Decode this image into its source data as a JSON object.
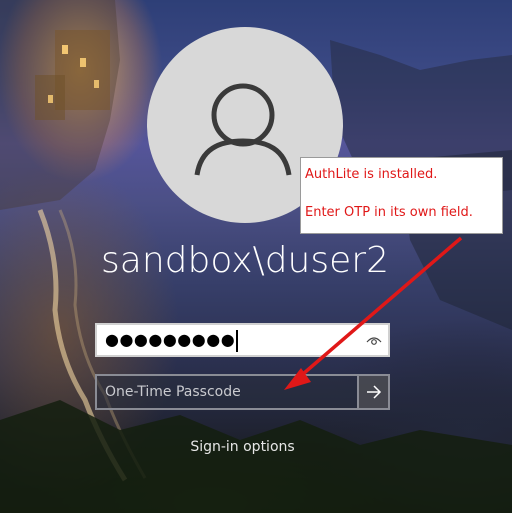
{
  "user": {
    "avatar_icon": "user-silhouette-icon",
    "username": "sandbox\\duser2"
  },
  "password": {
    "masked_value": "●●●●●●●●●",
    "reveal_icon": "eye-icon"
  },
  "otp": {
    "placeholder": "One-Time Passcode",
    "submit_icon": "arrow-right-icon"
  },
  "signin_options": {
    "label": "Sign-in options"
  },
  "annotation": {
    "line1": "AuthLite is installed.",
    "line2": "Enter OTP in its own field.",
    "color": "#e01818"
  }
}
